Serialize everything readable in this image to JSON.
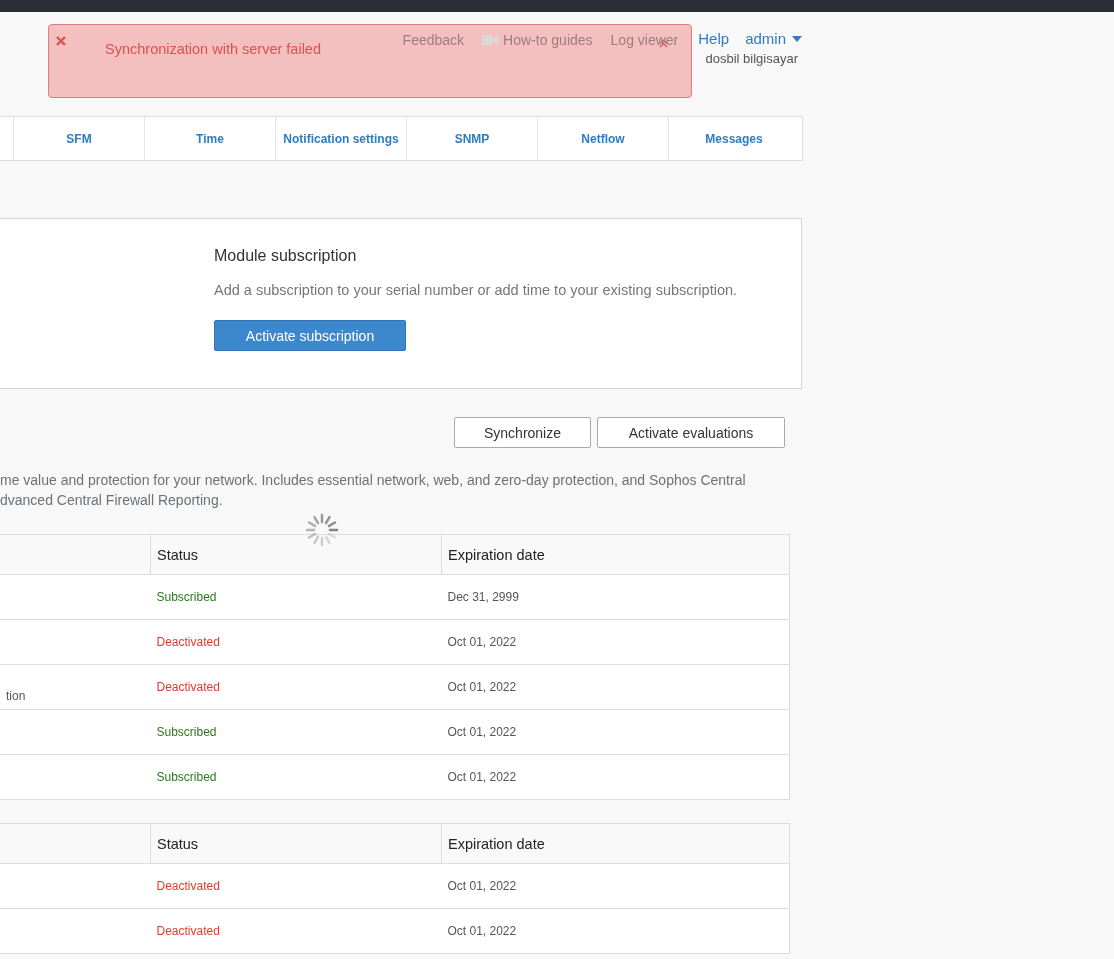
{
  "header": {
    "links": [
      {
        "label": "Feedback",
        "kind": "text"
      },
      {
        "label": "How-to guides",
        "kind": "video"
      },
      {
        "label": "Log viewer",
        "kind": "text"
      }
    ],
    "help": "Help",
    "user": "admin",
    "device": "dosbil bilgisayar"
  },
  "alert": {
    "message": "Synchronization with server failed"
  },
  "tabs": [
    {
      "label": "SFM",
      "selected": false
    },
    {
      "label": "Time",
      "selected": false
    },
    {
      "label": "Notification settings",
      "selected": false
    },
    {
      "label": "SNMP",
      "selected": false
    },
    {
      "label": "Netflow",
      "selected": false
    },
    {
      "label": "Messages",
      "selected": false
    }
  ],
  "module_card": {
    "title": "Module subscription",
    "text": "Add a subscription to your serial number or add time to your existing subscription.",
    "button": "Activate subscription"
  },
  "actions": [
    "Synchronize",
    "Activate evaluations"
  ],
  "description": [
    "me value and protection for your network. Includes essential network, web, and zero-day protection, and Sophos Central",
    "dvanced Central Firewall Reporting."
  ],
  "tables": [
    {
      "columns": [
        "Status",
        "Expiration date"
      ],
      "rows": [
        {
          "status": "Subscribed",
          "kind": "subscribed",
          "expiration": "Dec 31, 2999"
        },
        {
          "status": "Deactivated",
          "kind": "deactivated",
          "expiration": "Oct 01, 2022"
        },
        {
          "column_1": "tion",
          "status": "Deactivated",
          "kind": "deactivated",
          "expiration": "Oct 01, 2022"
        },
        {
          "status": "Subscribed",
          "kind": "subscribed",
          "expiration": "Oct 01, 2022"
        },
        {
          "status": "Subscribed",
          "kind": "subscribed",
          "expiration": "Oct 01, 2022"
        }
      ]
    },
    {
      "columns": [
        "Status",
        "Expiration date"
      ],
      "rows": [
        {
          "status": "Deactivated",
          "kind": "deactivated",
          "expiration": "Oct 01, 2022"
        },
        {
          "status": "Deactivated",
          "kind": "deactivated",
          "expiration": "Oct 01, 2022"
        }
      ]
    }
  ]
}
